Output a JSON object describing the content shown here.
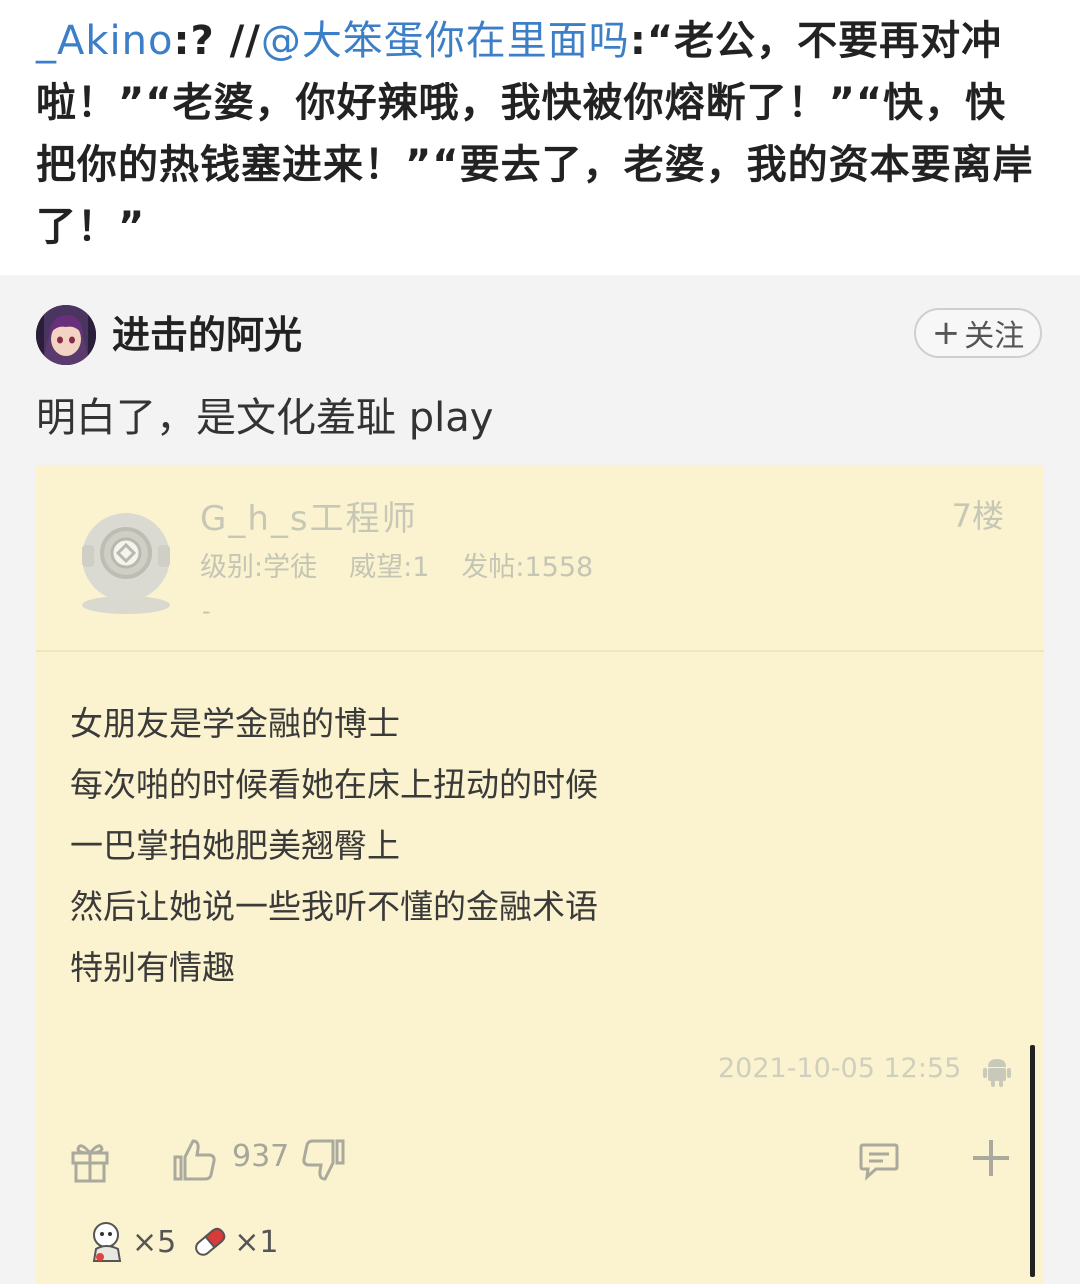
{
  "repost": {
    "username": "_Akino",
    "separator": ":? //",
    "mention": "@大笨蛋你在里面吗",
    "colon": ":",
    "text": "“老公，不要再对冲啦！”“老婆，你好辣哦，我快被你熔断了！”“快，快把你的热钱塞进来！”“要去了，老婆，我的资本要离岸了！”"
  },
  "comment": {
    "author": "进击的阿光",
    "follow_label": "关注",
    "follow_plus": "+",
    "text": "明白了，是文化羞耻 play"
  },
  "embedded_post": {
    "poster_name": "G_h_s工程师",
    "meta": {
      "level": "级别:学徒",
      "prestige": "威望:1",
      "posts": "发帖:1558"
    },
    "meta_dot": "-",
    "floor": "7楼",
    "body_lines": [
      "女朋友是学金融的博士",
      "每次啪的时候看她在床上扭动的时候",
      "一巴掌拍她肥美翘臀上",
      "然后让她说一些我听不懂的金融术语",
      "特别有情趣"
    ],
    "timestamp": "2021-10-05 12:55",
    "like_count": "937",
    "rewards": [
      {
        "icon": "mascot-icon",
        "count": "×5"
      },
      {
        "icon": "pill-icon",
        "count": "×1"
      }
    ]
  },
  "colors": {
    "link": "#3d7fc7",
    "screenshot_bg": "#fbf3cf",
    "comment_bg": "#f3f3f3"
  }
}
